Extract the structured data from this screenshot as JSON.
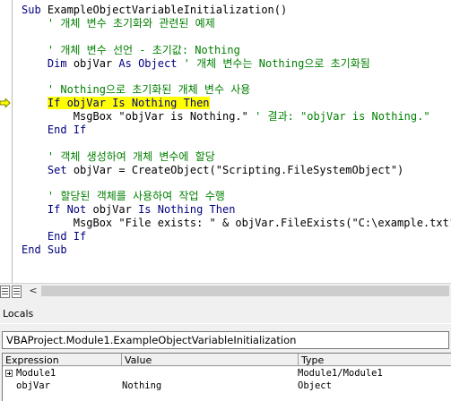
{
  "editor": {
    "lines": [
      [
        {
          "t": "Sub ",
          "c": "kw"
        },
        {
          "t": "ExampleObjectVariableInitialization()",
          "c": "id"
        }
      ],
      [
        {
          "t": "    ' 개체 변수 초기화와 관련된 예제",
          "c": "cm"
        }
      ],
      [
        {
          "t": "",
          "c": "id"
        }
      ],
      [
        {
          "t": "    ' 개체 변수 선언 - 초기값: Nothing",
          "c": "cm"
        }
      ],
      [
        {
          "t": "    ",
          "c": "id"
        },
        {
          "t": "Dim ",
          "c": "kw"
        },
        {
          "t": "objVar ",
          "c": "id"
        },
        {
          "t": "As Object ",
          "c": "kw"
        },
        {
          "t": "' 개체 변수는 Nothing으로 초기화됨",
          "c": "cm"
        }
      ],
      [
        {
          "t": "",
          "c": "id"
        }
      ],
      [
        {
          "t": "    ' Nothing으로 초기화된 개체 변수 사용",
          "c": "cm"
        }
      ],
      [
        {
          "t": "    ",
          "c": "id"
        },
        {
          "t": "If objVar Is Nothing Then",
          "c": "kw hl"
        }
      ],
      [
        {
          "t": "        MsgBox \"objVar is Nothing.\" ",
          "c": "id"
        },
        {
          "t": "' 결과: \"objVar is Nothing.\"",
          "c": "cm"
        }
      ],
      [
        {
          "t": "    ",
          "c": "id"
        },
        {
          "t": "End If",
          "c": "kw"
        }
      ],
      [
        {
          "t": "",
          "c": "id"
        }
      ],
      [
        {
          "t": "    ' 객체 생성하여 개체 변수에 할당",
          "c": "cm"
        }
      ],
      [
        {
          "t": "    ",
          "c": "id"
        },
        {
          "t": "Set ",
          "c": "kw"
        },
        {
          "t": "objVar = CreateObject(\"Scripting.FileSystemObject\")",
          "c": "id"
        }
      ],
      [
        {
          "t": "",
          "c": "id"
        }
      ],
      [
        {
          "t": "    ' 할당된 객체를 사용하여 작업 수행",
          "c": "cm"
        }
      ],
      [
        {
          "t": "    ",
          "c": "id"
        },
        {
          "t": "If Not ",
          "c": "kw"
        },
        {
          "t": "objVar ",
          "c": "id"
        },
        {
          "t": "Is Nothing Then",
          "c": "kw"
        }
      ],
      [
        {
          "t": "        MsgBox \"File exists: \" & objVar.FileExists(\"C:\\example.txt\")",
          "c": "id"
        }
      ],
      [
        {
          "t": "    ",
          "c": "id"
        },
        {
          "t": "End If",
          "c": "kw"
        }
      ],
      [
        {
          "t": "End Sub",
          "c": "kw"
        }
      ]
    ],
    "exec_arrow_icon": "current-line-arrow-icon",
    "highlight_color": "#ffff00"
  },
  "locals": {
    "title": "Locals",
    "context": "VBAProject.Module1.ExampleObjectVariableInitialization",
    "columns": {
      "expression": "Expression",
      "value": "Value",
      "type": "Type"
    },
    "rows": [
      {
        "expression": "Module1",
        "value": "",
        "type": "Module1/Module1",
        "expandable": true
      },
      {
        "expression": "objVar",
        "value": "Nothing",
        "type": "Object",
        "expandable": false
      }
    ]
  }
}
